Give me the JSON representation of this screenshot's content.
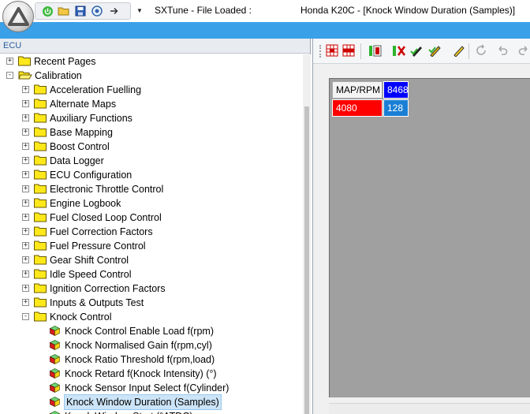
{
  "title": {
    "app": "SXTune - File Loaded :",
    "document": "Honda K20C - [Knock Window Duration (Samples)]"
  },
  "quick_access": [
    "power-icon",
    "open-folder-icon",
    "save-icon",
    "search-icon",
    "forward-icon"
  ],
  "colors": {
    "accent": "#3aa0e8",
    "header_text": "#2a5f9e",
    "cell_red": "#ff0000",
    "cell_blue": "#0000ff",
    "cell_value": "#1a7fd4"
  },
  "left_panel": {
    "header": "ECU",
    "tree": [
      {
        "label": "Recent Pages",
        "expander": "+",
        "icon": "folder-icon",
        "level": 0
      },
      {
        "label": "Calibration",
        "expander": "-",
        "icon": "open-folder-icon",
        "level": 0
      },
      {
        "label": "Acceleration Fuelling",
        "expander": "+",
        "icon": "folder-icon",
        "level": 1
      },
      {
        "label": "Alternate Maps",
        "expander": "+",
        "icon": "folder-icon",
        "level": 1
      },
      {
        "label": "Auxiliary Functions",
        "expander": "+",
        "icon": "folder-icon",
        "level": 1
      },
      {
        "label": "Base Mapping",
        "expander": "+",
        "icon": "folder-icon",
        "level": 1
      },
      {
        "label": "Boost Control",
        "expander": "+",
        "icon": "folder-icon",
        "level": 1
      },
      {
        "label": "Data Logger",
        "expander": "+",
        "icon": "folder-icon",
        "level": 1
      },
      {
        "label": "ECU Configuration",
        "expander": "+",
        "icon": "folder-icon",
        "level": 1
      },
      {
        "label": "Electronic Throttle Control",
        "expander": "+",
        "icon": "folder-icon",
        "level": 1
      },
      {
        "label": "Engine Logbook",
        "expander": "+",
        "icon": "folder-icon",
        "level": 1
      },
      {
        "label": "Fuel Closed Loop Control",
        "expander": "+",
        "icon": "folder-icon",
        "level": 1
      },
      {
        "label": "Fuel Correction Factors",
        "expander": "+",
        "icon": "folder-icon",
        "level": 1
      },
      {
        "label": "Fuel Pressure Control",
        "expander": "+",
        "icon": "folder-icon",
        "level": 1
      },
      {
        "label": "Gear Shift Control",
        "expander": "+",
        "icon": "folder-icon",
        "level": 1
      },
      {
        "label": "Idle Speed Control",
        "expander": "+",
        "icon": "folder-icon",
        "level": 1
      },
      {
        "label": "Ignition Correction Factors",
        "expander": "+",
        "icon": "folder-icon",
        "level": 1
      },
      {
        "label": "Inputs & Outputs Test",
        "expander": "+",
        "icon": "folder-icon",
        "level": 1
      },
      {
        "label": "Knock Control",
        "expander": "-",
        "icon": "folder-icon",
        "level": 1
      },
      {
        "label": "Knock Control Enable Load f(rpm)",
        "expander": "",
        "icon": "map-cube-icon",
        "level": 2
      },
      {
        "label": "Knock Normalised Gain f(rpm,cyl)",
        "expander": "",
        "icon": "map-cube-icon",
        "level": 2
      },
      {
        "label": "Knock Ratio Threshold f(rpm,load)",
        "expander": "",
        "icon": "map-cube-icon",
        "level": 2
      },
      {
        "label": "Knock Retard f(Knock Intensity) (°)",
        "expander": "",
        "icon": "map-cube-icon",
        "level": 2
      },
      {
        "label": "Knock Sensor Input Select f(Cylinder)",
        "expander": "",
        "icon": "map-cube-icon",
        "level": 2
      },
      {
        "label": "Knock Window Duration (Samples)",
        "expander": "",
        "icon": "map-cube-icon",
        "level": 2,
        "selected": true
      },
      {
        "label": "Knock Window Start (°ATDC)",
        "expander": "",
        "icon": "map-cube-icon",
        "level": 2
      }
    ]
  },
  "toolbar": [
    "red-grid-down-icon",
    "red-grid-up-icon",
    "green-bar-icon",
    "red-x-icon",
    "pencil-check-icon",
    "pencil-check-yellow-icon",
    "pencil-icon",
    "refresh-icon",
    "undo-icon",
    "redo-icon"
  ],
  "table": {
    "corner": "MAP/RPM",
    "rpm": "8468",
    "map": "4080",
    "value": "128"
  }
}
